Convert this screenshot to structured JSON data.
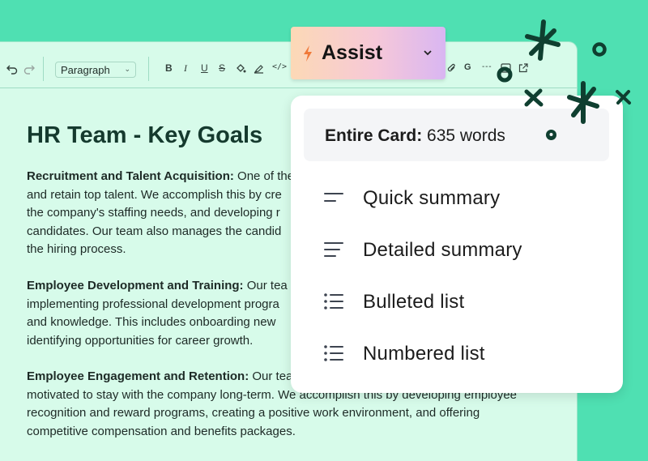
{
  "toolbar": {
    "paragraph_select": "Paragraph",
    "icons": [
      "undo-icon",
      "redo-icon",
      "bold-icon",
      "italic-icon",
      "underline-icon",
      "strikethrough-icon",
      "fill-color-icon",
      "highlight-icon",
      "code-icon",
      "attachment-icon",
      "mention-icon",
      "divider-icon",
      "image-icon",
      "external-link-icon"
    ]
  },
  "document": {
    "title": "HR Team - Key Goals",
    "sections": [
      {
        "heading": "Recruitment and Talent Acquisition:",
        "lines": [
          " One of the",
          "and retain top talent. We accomplish this by cre",
          "the company's staffing needs, and developing r",
          "candidates. Our team also manages the candid",
          "the hiring process."
        ]
      },
      {
        "heading": "Employee Development and Training:",
        "lines": [
          " Our tea",
          "implementing professional development progra",
          "and knowledge. This includes onboarding new",
          "identifying opportunities for career growth."
        ]
      },
      {
        "heading": "Employee Engagement and Retention:",
        "lines": [
          " Our tea",
          "motivated to stay with the company long-term. We accomplish this by developing employee",
          "recognition and reward programs, creating a positive work environment, and offering",
          "competitive compensation and benefits packages."
        ]
      }
    ]
  },
  "assist": {
    "label": "Assist",
    "icon": "lightning-icon",
    "accent": "#f07a3a"
  },
  "popup": {
    "word_count_label": "Entire Card:",
    "word_count_value": " 635 words",
    "items": [
      {
        "label": "Quick summary",
        "icon": "short-lines-icon"
      },
      {
        "label": "Detailed summary",
        "icon": "lines-icon"
      },
      {
        "label": "Bulleted list",
        "icon": "bulleted-list-icon"
      },
      {
        "label": "Numbered list",
        "icon": "numbered-list-icon"
      }
    ]
  },
  "colors": {
    "background": "#4fe0b2",
    "editor": "#d7fbea",
    "doodle": "#0f3f30"
  }
}
